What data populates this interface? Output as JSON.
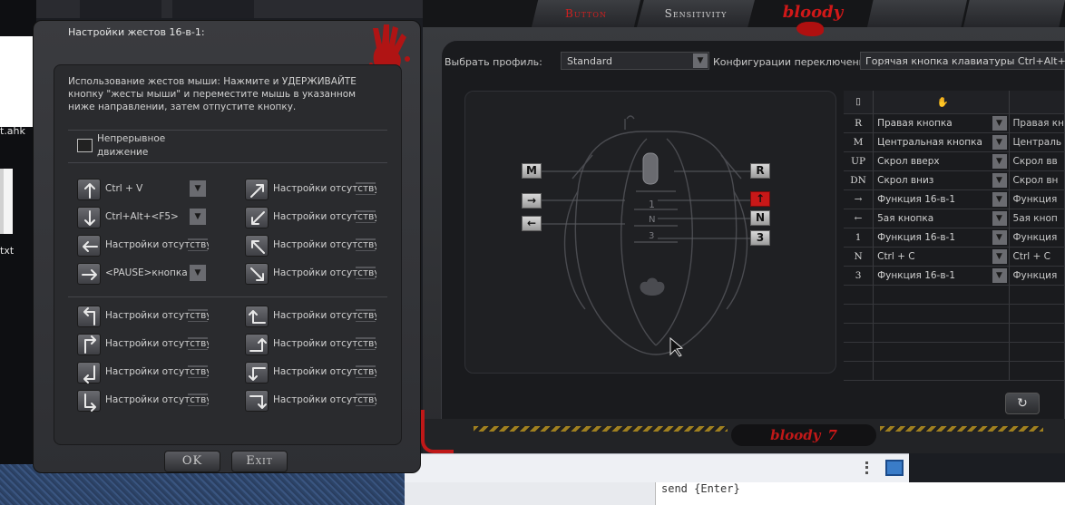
{
  "desktop": {
    "file1_label": "t.ahk",
    "file2_label": "txt"
  },
  "main_window": {
    "tabs": [
      "Button",
      "Sensitivity",
      "",
      ""
    ],
    "logo_top": "bloody",
    "profile_label": "Выбрать профиль:",
    "profile_value": "Standard",
    "config_label": "Конфигурации переключения :",
    "config_value": "Горячая кнопка клавиатуры   Ctrl+Alt+E",
    "mouse_buttons": [
      "M",
      "R",
      "→",
      "↑",
      "←",
      "N",
      "3"
    ],
    "table": {
      "header_icons": [
        "mouse-icon",
        "hand-icon"
      ],
      "rows": [
        {
          "key": "R",
          "func": "Правая кнопка",
          "extra": "Правая кн"
        },
        {
          "key": "M",
          "func": "Центральная кнопка",
          "extra": "Централь"
        },
        {
          "key": "UP",
          "func": "Скрол вверх",
          "extra": "Скрол вв"
        },
        {
          "key": "DN",
          "func": "Скрол вниз",
          "extra": "Скрол вн"
        },
        {
          "key": "→",
          "func": "Функция 16-в-1",
          "extra": "Функция"
        },
        {
          "key": "←",
          "func": "5ая кнопка",
          "extra": "5ая кноп"
        },
        {
          "key": "1",
          "func": "Функция 16-в-1",
          "extra": "Функция"
        },
        {
          "key": "N",
          "func": "Ctrl + C",
          "extra": "Ctrl + C"
        },
        {
          "key": "3",
          "func": "Функция 16-в-1",
          "extra": "Функция"
        }
      ]
    },
    "logo_bottom": "bloody",
    "logo_bottom_num": "7"
  },
  "editor": {
    "line": "send {Enter}"
  },
  "dialog": {
    "title": "Настройки жестов 16-в-1:",
    "description": "Использование жестов мыши: Нажмите и УДЕРЖИВАЙТЕ кнопку \"жесты мыши\" и переместите мышь в указанном ниже направлении, затем отпустите кнопку.",
    "continuous_label": "Непрерывное движение",
    "gestures": [
      {
        "icon": "arrow-up-icon",
        "label": "Ctrl + V",
        "dropdown": true
      },
      {
        "icon": "arrow-up-right-icon",
        "label": "Настройки отсутствуют",
        "dropdown": false
      },
      {
        "icon": "arrow-down-icon",
        "label": "Ctrl+Alt+<F5>",
        "dropdown": true
      },
      {
        "icon": "arrow-down-left-icon",
        "label": "Настройки отсутствуют",
        "dropdown": false
      },
      {
        "icon": "arrow-left-icon",
        "label": "Настройки отсутствуют",
        "dropdown": false
      },
      {
        "icon": "arrow-up-left-icon",
        "label": "Настройки отсутствуют",
        "dropdown": false
      },
      {
        "icon": "arrow-right-icon",
        "label": "<PAUSE>кнопка",
        "dropdown": true
      },
      {
        "icon": "arrow-down-right-icon",
        "label": "Настройки отсутствуют",
        "dropdown": false
      },
      {
        "icon": "up-then-left-icon",
        "label": "Настройки отсутствуют",
        "dropdown": false
      },
      {
        "icon": "left-then-up-icon",
        "label": "Настройки отсутствуют",
        "dropdown": false
      },
      {
        "icon": "up-then-right-icon",
        "label": "Настройки отсутствуют",
        "dropdown": false
      },
      {
        "icon": "right-then-up-icon",
        "label": "Настройки отсутствуют",
        "dropdown": false
      },
      {
        "icon": "down-then-left-icon",
        "label": "Настройки отсутствуют",
        "dropdown": false
      },
      {
        "icon": "left-then-down-icon",
        "label": "Настройки отсутствуют",
        "dropdown": false
      },
      {
        "icon": "down-then-right-icon",
        "label": "Настройки отсутствуют",
        "dropdown": false
      },
      {
        "icon": "right-then-down-icon",
        "label": "Настройки отсутствуют",
        "dropdown": false
      }
    ],
    "ok_label": "OK",
    "exit_label": "Exit"
  },
  "colors": {
    "accent_red": "#c81818",
    "panel": "#2a2b2e"
  }
}
